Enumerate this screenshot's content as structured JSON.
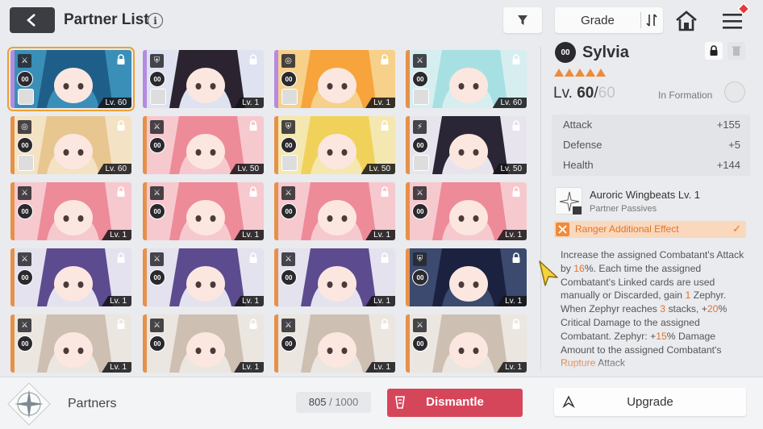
{
  "header": {
    "title": "Partner List",
    "info_glyph": "i",
    "sort_label": "Grade"
  },
  "colors": {
    "accent_orange": "#e2742c",
    "dismantle_red": "#d6465a",
    "selected_outline": "#f0a030"
  },
  "cards": [
    {
      "level": "Lv. 60",
      "selected": true,
      "stripe": "#b48be0",
      "bg": "#3a8fb8",
      "hair": "#1e5f8a",
      "type": "ranger",
      "has_sub": true
    },
    {
      "level": "Lv. 1",
      "stripe": "#b48be0",
      "bg": "#dfe2f0",
      "hair": "#2b2430",
      "type": "guard",
      "has_sub": true
    },
    {
      "level": "Lv. 1",
      "stripe": "#b48be0",
      "bg": "#f7d08a",
      "hair": "#f6a43b",
      "type": "striker",
      "has_sub": true
    },
    {
      "level": "Lv. 60",
      "stripe": "#e6914a",
      "bg": "#d7eef0",
      "hair": "#a7e0e3",
      "type": "ranger",
      "has_sub": true
    },
    {
      "level": "Lv. 60",
      "stripe": "#e6914a",
      "bg": "#f3e2c3",
      "hair": "#e8c690",
      "type": "striker",
      "has_sub": true
    },
    {
      "level": "Lv. 50",
      "stripe": "#e6914a",
      "bg": "#f6c9cf",
      "hair": "#ee8b99",
      "type": "ranger",
      "has_sub": false
    },
    {
      "level": "Lv. 50",
      "stripe": "#e6914a",
      "bg": "#f5e7b0",
      "hair": "#f0d25a",
      "type": "guard",
      "has_sub": true
    },
    {
      "level": "Lv. 50",
      "stripe": "#e6914a",
      "bg": "#e7e4ee",
      "hair": "#2a2636",
      "type": "psionic",
      "has_sub": true
    },
    {
      "level": "Lv. 1",
      "stripe": "#e6914a",
      "bg": "#f6c9cf",
      "hair": "#ee8b99",
      "type": "ranger",
      "has_sub": false
    },
    {
      "level": "Lv. 1",
      "stripe": "#e6914a",
      "bg": "#f6c9cf",
      "hair": "#ee8b99",
      "type": "ranger",
      "has_sub": false
    },
    {
      "level": "Lv. 1",
      "stripe": "#e6914a",
      "bg": "#f6c9cf",
      "hair": "#ee8b99",
      "type": "ranger",
      "has_sub": false
    },
    {
      "level": "Lv. 1",
      "stripe": "#e6914a",
      "bg": "#f6c9cf",
      "hair": "#ee8b99",
      "type": "ranger",
      "has_sub": false
    },
    {
      "level": "Lv. 1",
      "stripe": "#e6914a",
      "bg": "#e4e2ee",
      "hair": "#5d4b8f",
      "type": "ranger",
      "has_sub": false
    },
    {
      "level": "Lv. 1",
      "stripe": "#e6914a",
      "bg": "#e4e2ee",
      "hair": "#5d4b8f",
      "type": "ranger",
      "has_sub": false
    },
    {
      "level": "Lv. 1",
      "stripe": "#e6914a",
      "bg": "#e4e2ee",
      "hair": "#5d4b8f",
      "type": "ranger",
      "has_sub": false
    },
    {
      "level": "Lv. 1",
      "stripe": "#e6914a",
      "bg": "#3b4a6e",
      "hair": "#1b2240",
      "type": "guard",
      "has_sub": false
    },
    {
      "level": "Lv. 1",
      "stripe": "#e6914a",
      "bg": "#ebe6e0",
      "hair": "#cdbfb2",
      "type": "ranger",
      "has_sub": false
    },
    {
      "level": "Lv. 1",
      "stripe": "#e6914a",
      "bg": "#ebe6e0",
      "hair": "#cdbfb2",
      "type": "ranger",
      "has_sub": false
    },
    {
      "level": "Lv. 1",
      "stripe": "#e6914a",
      "bg": "#ebe6e0",
      "hair": "#cdbfb2",
      "type": "ranger",
      "has_sub": false
    },
    {
      "level": "Lv. 1",
      "stripe": "#e6914a",
      "bg": "#ebe6e0",
      "hair": "#cdbfb2",
      "type": "ranger",
      "has_sub": false
    }
  ],
  "detail": {
    "rank_glyph": "00",
    "name": "Sylvia",
    "star_count": 5,
    "level_prefix": "Lv. ",
    "level_current": "60",
    "level_sep": "/",
    "level_max": "60",
    "formation_label": "In Formation",
    "stats": [
      {
        "name": "Attack",
        "value": "+155"
      },
      {
        "name": "Defense",
        "value": "+5"
      },
      {
        "name": "Health",
        "value": "+144"
      }
    ],
    "passive_name": "Auroric Wingbeats Lv. 1",
    "passive_sub": "Partner Passives",
    "effect_label": "Ranger Additional Effect",
    "effect_check": "✓",
    "desc": [
      {
        "t": "Increase the assigned Combatant's Attack by "
      },
      {
        "t": "16",
        "hl": true
      },
      {
        "t": "%. Each time the assigned Combatant's Linked cards are used manually or Discarded, gain "
      },
      {
        "t": "1",
        "hl": true
      },
      {
        "t": " Zephyr. When Zephyr reaches "
      },
      {
        "t": "3",
        "hl": true
      },
      {
        "t": " stacks, +"
      },
      {
        "t": "20",
        "hl": true
      },
      {
        "t": "% Critical Damage to the assigned Combatant. Zephyr: +"
      },
      {
        "t": "15",
        "hl": true
      },
      {
        "t": "% Damage Amount to the assigned Combatant's "
      },
      {
        "t": "Rupture",
        "hl": true
      },
      {
        "t": " Attack"
      }
    ]
  },
  "footer": {
    "partners_label": "Partners",
    "count_current": "805",
    "count_sep": " / ",
    "count_max": "1000",
    "dismantle_label": "Dismantle",
    "upgrade_label": "Upgrade"
  }
}
